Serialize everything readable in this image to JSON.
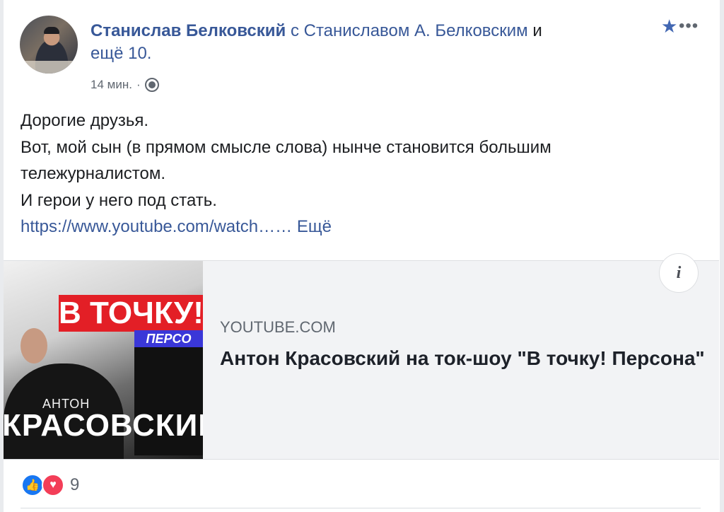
{
  "post": {
    "author": "Станислав Белковский",
    "with_text": "с Станиславом А. Белковским",
    "and_text": "и",
    "others_text": "ещё 10.",
    "timestamp": "14 мин.",
    "separator": "·",
    "body_lines": [
      "Дорогие друзья.",
      "Вот, мой сын (в прямом смысле слова) нынче становится большим",
      "тележурналистом.",
      "И герои у него под стать."
    ],
    "link_text": "https://www.youtube.com/watch……",
    "more_text": "Ещё"
  },
  "attachment": {
    "source": "YOUTUBE.COM",
    "title": "Антон Красовский на ток-шоу \"В точку! Персона\"",
    "thumbnail": {
      "brand_text": "В ТОЧКУ!",
      "brand_subtext": "ПЕРСО",
      "name_small": "АНТОН",
      "name_large": "КРАСОВСКИЙ"
    },
    "info_icon": "i"
  },
  "reactions": {
    "count": "9",
    "icons": [
      "like-icon",
      "love-icon"
    ]
  },
  "icons": {
    "star": "★",
    "more": "•••",
    "like": "👍",
    "love": "♥"
  },
  "colors": {
    "link_blue": "#385898",
    "brand_red": "#e31f26",
    "brand_blue": "#3a37d8"
  }
}
